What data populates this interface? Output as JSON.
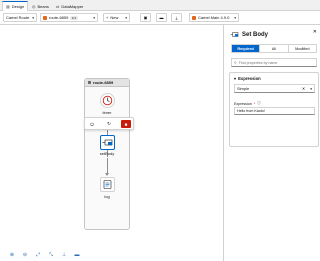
{
  "tabs": [
    {
      "label": "Design",
      "icon": "design-icon"
    },
    {
      "label": "Beans",
      "icon": "beans-icon"
    },
    {
      "label": "DataMapper",
      "icon": "datamapper-icon"
    }
  ],
  "toolbar": {
    "resource_type": "Camel Route",
    "route_name": "route-6859",
    "route_count": "1/1",
    "new_label": "New",
    "catalog_label": "Camel Main 4.9.0"
  },
  "canvas": {
    "route_title": "route-6859",
    "nodes": [
      {
        "label": "timer",
        "icon": "timer-icon"
      },
      {
        "label": "setBody",
        "icon": "setbody-icon"
      },
      {
        "label": "log",
        "icon": "log-icon"
      }
    ]
  },
  "panel": {
    "title": "Set Body",
    "filters": [
      "Required",
      "All",
      "Modified"
    ],
    "active_filter": "Required",
    "search_placeholder": "Find properties by name",
    "section_title": "Expression",
    "language_value": "Simple",
    "field_label": "Expression",
    "field_required_mark": "*",
    "field_value": "Hello from Kaoto!"
  },
  "colors": {
    "accent": "#0066cc",
    "danger": "#c9190b",
    "camel": "#e4651d"
  }
}
